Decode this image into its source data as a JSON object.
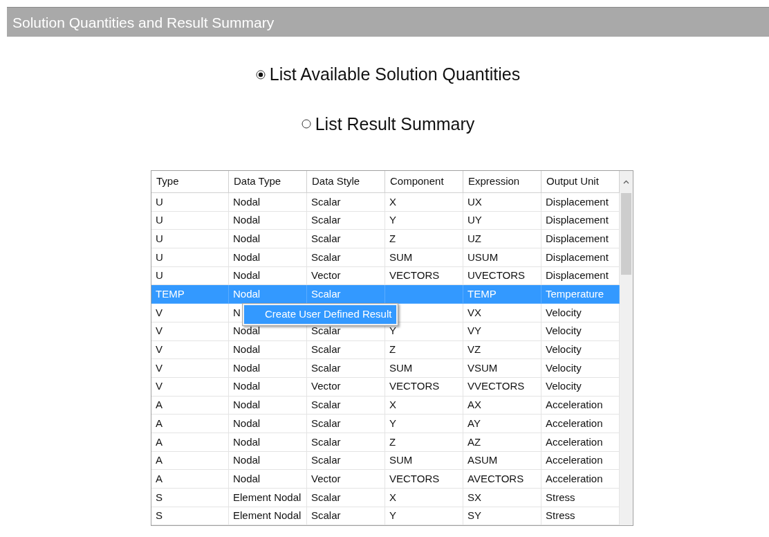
{
  "panel": {
    "title": "Solution Quantities and Result Summary"
  },
  "options": [
    {
      "label": "List Available Solution Quantities",
      "selected": true
    },
    {
      "label": "List Result Summary",
      "selected": false
    }
  ],
  "table": {
    "columns": [
      "Type",
      "Data Type",
      "Data Style",
      "Component",
      "Expression",
      "Output Unit"
    ],
    "rows": [
      {
        "cells": {
          "type": "U",
          "data_type": "Nodal",
          "data_style": "Scalar",
          "component": "X",
          "expression": "UX",
          "output_unit": "Displacement"
        },
        "selected": false
      },
      {
        "cells": {
          "type": "U",
          "data_type": "Nodal",
          "data_style": "Scalar",
          "component": "Y",
          "expression": "UY",
          "output_unit": "Displacement"
        },
        "selected": false
      },
      {
        "cells": {
          "type": "U",
          "data_type": "Nodal",
          "data_style": "Scalar",
          "component": "Z",
          "expression": "UZ",
          "output_unit": "Displacement"
        },
        "selected": false
      },
      {
        "cells": {
          "type": "U",
          "data_type": "Nodal",
          "data_style": "Scalar",
          "component": "SUM",
          "expression": "USUM",
          "output_unit": "Displacement"
        },
        "selected": false
      },
      {
        "cells": {
          "type": "U",
          "data_type": "Nodal",
          "data_style": "Vector",
          "component": "VECTORS",
          "expression": "UVECTORS",
          "output_unit": "Displacement"
        },
        "selected": false
      },
      {
        "cells": {
          "type": "TEMP",
          "data_type": "Nodal",
          "data_style": "Scalar",
          "expression": "TEMP",
          "output_unit": "Temperature"
        },
        "selected": true
      },
      {
        "cells": {
          "type": "V",
          "data_type": "N",
          "expression": "VX",
          "output_unit": "Velocity"
        },
        "selected": false
      },
      {
        "cells": {
          "type": "V",
          "data_type": "Nodal",
          "data_style": "Scalar",
          "component": "Y",
          "expression": "VY",
          "output_unit": "Velocity"
        },
        "selected": false
      },
      {
        "cells": {
          "type": "V",
          "data_type": "Nodal",
          "data_style": "Scalar",
          "component": "Z",
          "expression": "VZ",
          "output_unit": "Velocity"
        },
        "selected": false
      },
      {
        "cells": {
          "type": "V",
          "data_type": "Nodal",
          "data_style": "Scalar",
          "component": "SUM",
          "expression": "VSUM",
          "output_unit": "Velocity"
        },
        "selected": false
      },
      {
        "cells": {
          "type": "V",
          "data_type": "Nodal",
          "data_style": "Vector",
          "component": "VECTORS",
          "expression": "VVECTORS",
          "output_unit": "Velocity"
        },
        "selected": false
      },
      {
        "cells": {
          "type": "A",
          "data_type": "Nodal",
          "data_style": "Scalar",
          "component": "X",
          "expression": "AX",
          "output_unit": "Acceleration"
        },
        "selected": false
      },
      {
        "cells": {
          "type": "A",
          "data_type": "Nodal",
          "data_style": "Scalar",
          "component": "Y",
          "expression": "AY",
          "output_unit": "Acceleration"
        },
        "selected": false
      },
      {
        "cells": {
          "type": "A",
          "data_type": "Nodal",
          "data_style": "Scalar",
          "component": "Z",
          "expression": "AZ",
          "output_unit": "Acceleration"
        },
        "selected": false
      },
      {
        "cells": {
          "type": "A",
          "data_type": "Nodal",
          "data_style": "Scalar",
          "component": "SUM",
          "expression": "ASUM",
          "output_unit": "Acceleration"
        },
        "selected": false
      },
      {
        "cells": {
          "type": "A",
          "data_type": "Nodal",
          "data_style": "Vector",
          "component": "VECTORS",
          "expression": "AVECTORS",
          "output_unit": "Acceleration"
        },
        "selected": false
      },
      {
        "cells": {
          "type": "S",
          "data_type": "Element Nodal",
          "data_style": "Scalar",
          "component": "X",
          "expression": "SX",
          "output_unit": "Stress"
        },
        "selected": false
      },
      {
        "cells": {
          "type": "S",
          "data_type": "Element Nodal",
          "data_style": "Scalar",
          "component": "Y",
          "expression": "SY",
          "output_unit": "Stress"
        },
        "selected": false
      }
    ]
  },
  "context_menu": {
    "items": [
      "Create User Defined Result"
    ]
  }
}
